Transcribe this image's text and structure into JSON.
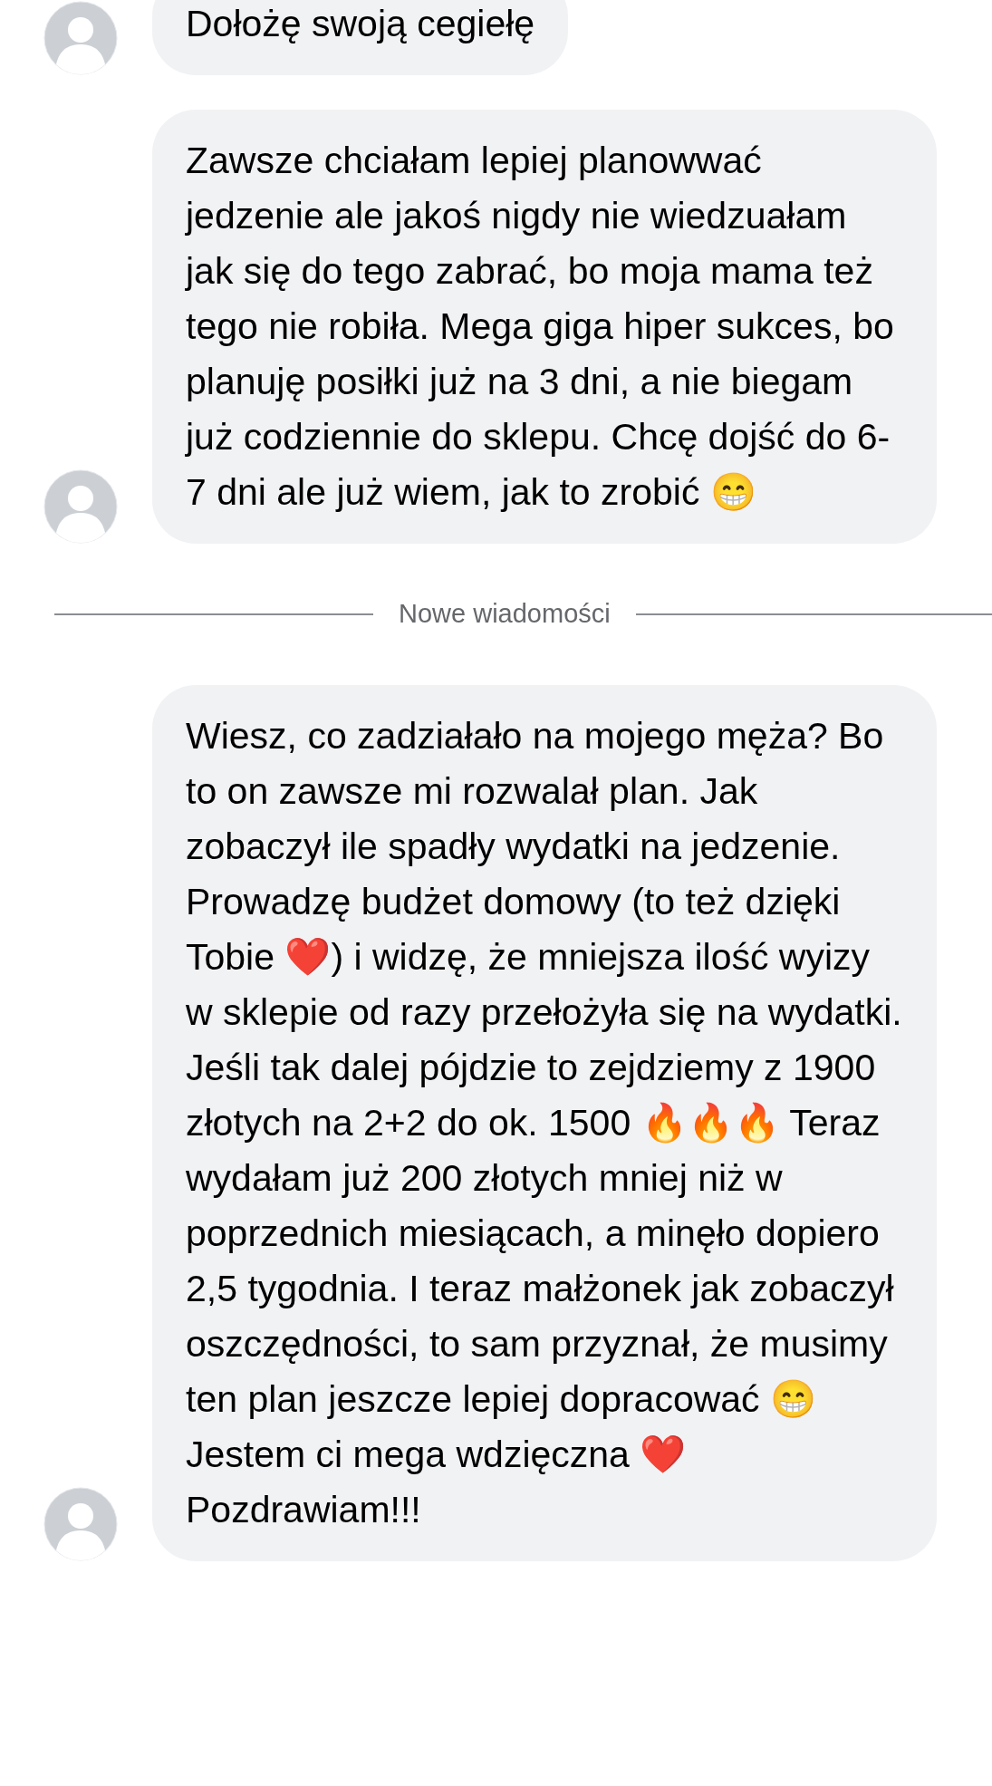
{
  "messages_before": [
    {
      "text": "Dołożę swoją cegiełę"
    },
    {
      "text": "Zawsze chciałam lepiej planowwać jedzenie ale jakoś nigdy nie wiedzuałam jak się do tego zabrać, bo moja mama też tego nie robiła. Mega giga hiper sukces, bo planuję posiłki już na 3 dni, a nie biegam już codziennie do sklepu. Chcę dojść do 6-7 dni ale już wiem, jak to zrobić 😁"
    }
  ],
  "divider": {
    "label": "Nowe wiadomości"
  },
  "messages_after": [
    {
      "text": "Wiesz, co zadziałało na mojego męża? Bo to on zawsze mi rozwalał plan. Jak zobaczył ile spadły wydatki na jedzenie. Prowadzę budżet domowy (to też dzięki Tobie ❤️) i widzę, że mniejsza ilość wyizy w sklepie od razy przełożyła się na wydatki. Jeśli tak dalej pójdzie to zejdziemy z 1900 złotych na 2+2 do ok. 1500 🔥🔥🔥 Teraz wydałam już 200 złotych mniej niż w poprzednich miesiącach, a minęło dopiero 2,5 tygodnia. I teraz małżonek jak zobaczył oszczędności, to sam przyznał, że musimy ten plan jeszcze lepiej dopracować 😁 Jestem ci mega wdzięczna ❤️ Pozdrawiam!!!"
    }
  ]
}
